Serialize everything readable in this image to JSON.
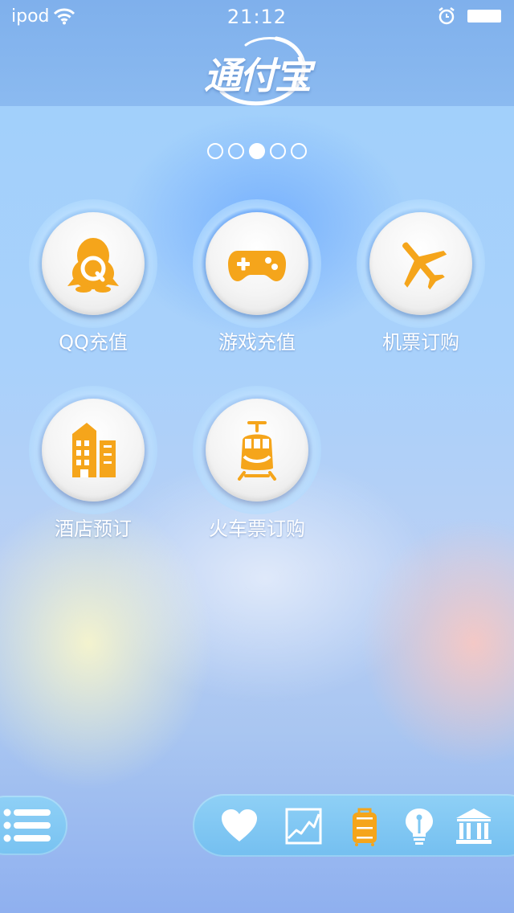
{
  "status_bar": {
    "carrier": "ipod",
    "time": "21:12",
    "wifi_icon": "wifi-icon",
    "alarm_icon": "alarm-clock-icon",
    "battery_icon": "battery-icon"
  },
  "header": {
    "logo_text": "通付宝"
  },
  "pager": {
    "page_count": 5,
    "active_index": 2
  },
  "services": [
    {
      "label": "QQ充值",
      "icon": "qq-penguin-icon"
    },
    {
      "label": "游戏充值",
      "icon": "gamepad-icon"
    },
    {
      "label": "机票订购",
      "icon": "airplane-icon"
    },
    {
      "label": "酒店预订",
      "icon": "hotel-building-icon"
    },
    {
      "label": "火车票订购",
      "icon": "train-icon"
    }
  ],
  "bottom_bar": {
    "menu_icon": "list-menu-icon",
    "tabs": [
      {
        "icon": "heart-icon",
        "active": false
      },
      {
        "icon": "chart-trend-icon",
        "active": false
      },
      {
        "icon": "suitcase-icon",
        "active": true
      },
      {
        "icon": "lightbulb-icon",
        "active": false
      },
      {
        "icon": "bank-icon",
        "active": false
      }
    ]
  },
  "colors": {
    "accent_orange": "#f5a51b",
    "header_blue": "#86b6ee",
    "bar_blue": "#7fc8f3",
    "text_white": "#ffffff"
  }
}
